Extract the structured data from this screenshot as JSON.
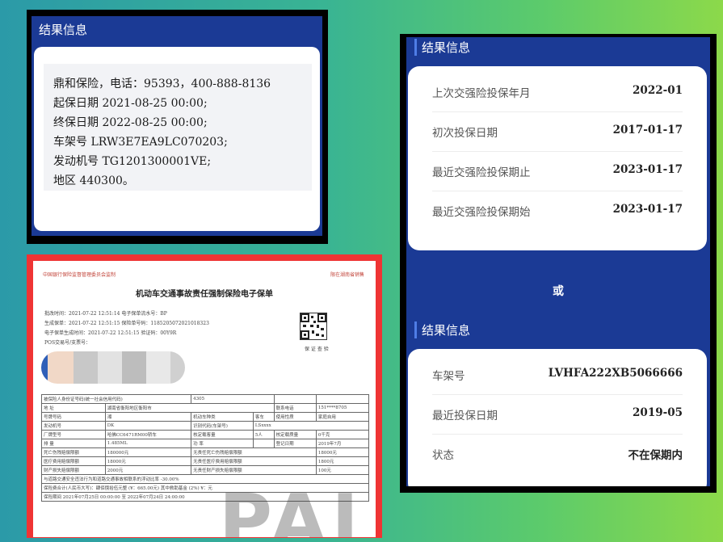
{
  "top_left": {
    "title": "结果信息",
    "lines": [
      "鼎和保险，电话：95393，400-888-8136",
      "起保日期 2021-08-25 00:00;",
      "终保日期 2022-08-25 00:00;",
      "车架号 LRW3E7EA9LC070203;",
      "发动机号 TG1201300001VE;",
      "地区 440300。"
    ]
  },
  "right": {
    "title_1": "结果信息",
    "card_1": [
      {
        "label": "上次交强险投保年月",
        "value": "2022-01"
      },
      {
        "label": "初次投保日期",
        "value": "2017-01-17"
      },
      {
        "label": "最近交强险投保期止",
        "value": "2023-01-17"
      },
      {
        "label": "最近交强险投保期始",
        "value": "2023-01-17"
      }
    ],
    "or_text": "或",
    "title_2": "结果信息",
    "card_2": [
      {
        "label": "车架号",
        "value": "LVHFA222XB5066666"
      },
      {
        "label": "最近投保日期",
        "value": "2019-05"
      },
      {
        "label": "状态",
        "value": "不在保期内"
      }
    ]
  },
  "policy_doc": {
    "header_left": "中国银行保险监督管理委员会监制",
    "header_right": "限在湖南省销售",
    "title": "机动车交通事故责任强制保险电子保单",
    "meta_lines": [
      "批改时间：2021-07-22 12:51:14   电子保单流水号：BP",
      "生成保单：2021-07-22 12:51:15   保险单号码：1185205072021018323",
      "电子保单生成时间：2021-07-22 12:51:15   验证码：00Y9R",
      "POS交易号/支票号："
    ],
    "stamp_text": "保 证 查 验",
    "rows": [
      [
        "被保险人身份证号码(统一社会信用代码)",
        "4305",
        "",
        ""
      ],
      [
        "地  址",
        "湖南省衡阳地区衡阳市",
        "联系电话",
        "151****8705"
      ],
      [
        "号牌号码",
        "湘",
        "机动车种类",
        "客车",
        "使用性质",
        "家庭自用"
      ],
      [
        "发动机号",
        "DK",
        "识别代码(车架号)",
        "LSxxxx"
      ],
      [
        "厂牌型号",
        "哈佛CC6471RM00轿车",
        "核定载客量",
        "5人",
        "核定载质量",
        "0千克"
      ],
      [
        "排  量",
        "1.485ML",
        "功  率",
        "",
        "登记日期",
        "2019年7月"
      ],
      [
        "死亡伤残赔偿限额",
        "180000元",
        "无责任死亡伤残赔偿限额",
        "18000元"
      ],
      [
        "医疗费用赔偿限额",
        "18000元",
        "无责任医疗费用赔偿限额",
        "1800元"
      ],
      [
        "财产损失赔偿限额",
        "2000元",
        "无责任财产损失赔偿限额",
        "100元"
      ],
      [
        "与道路交通安全违法行为和道路交通事故相联系的浮动比率  -30.00%"
      ],
      [
        "保险费合计(人民币大写)：肆佰捌拾伍元整 (¥：665.00元)   其中救助基金 (2%) ¥：元"
      ],
      [
        "保险期间  2021年07月25日 00:00:00 至 2022年07月24日 24:00:00"
      ]
    ],
    "watermark": "PAI"
  }
}
